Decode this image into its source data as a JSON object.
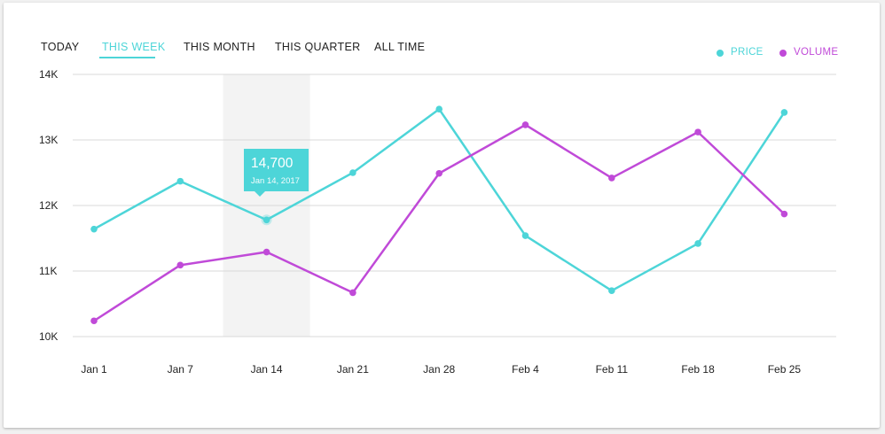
{
  "tabs": [
    {
      "label": "TODAY",
      "active": false
    },
    {
      "label": "THIS WEEK",
      "active": true
    },
    {
      "label": "THIS MONTH",
      "active": false
    },
    {
      "label": "THIS QUARTER",
      "active": false
    },
    {
      "label": "ALL TIME",
      "active": false
    }
  ],
  "legend": [
    {
      "label": "PRICE",
      "color": "#4dd5d8"
    },
    {
      "label": "VOLUME",
      "color": "#c04ad8"
    }
  ],
  "tooltip": {
    "value": "14,700",
    "date": "Jan 14, 2017"
  },
  "highlight_category": "Jan 14",
  "chart_data": {
    "type": "line",
    "categories": [
      "Jan 1",
      "Jan 7",
      "Jan 14",
      "Jan 21",
      "Jan 28",
      "Feb 4",
      "Feb 11",
      "Feb 18",
      "Feb 25"
    ],
    "series": [
      {
        "name": "PRICE",
        "color": "#4dd5d8",
        "values": [
          11640,
          12370,
          11780,
          12500,
          13470,
          11540,
          10700,
          11420,
          13420
        ]
      },
      {
        "name": "VOLUME",
        "color": "#c04ad8",
        "values": [
          10240,
          11090,
          11290,
          10670,
          12490,
          13230,
          12420,
          13120,
          11870
        ]
      }
    ],
    "yticks": [
      "10K",
      "11K",
      "12K",
      "13K",
      "14K"
    ],
    "ylim": [
      10000,
      14000
    ],
    "grid": true,
    "legend_position": "top-right"
  }
}
